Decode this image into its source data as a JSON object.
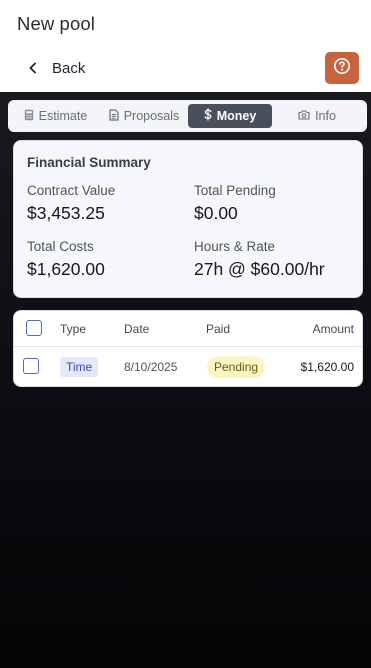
{
  "header": {
    "title": "New pool",
    "back_label": "Back",
    "back_icon": "chevron-left-icon",
    "help_icon": "question-circle-icon",
    "accent_color": "#c8633f"
  },
  "tabs": [
    {
      "label": "Estimate",
      "icon": "calculator-icon",
      "active": false
    },
    {
      "label": "Proposals",
      "icon": "document-icon",
      "active": false
    },
    {
      "label": "Money",
      "icon": "dollar-icon",
      "active": true
    },
    {
      "label": "Info",
      "icon": "camera-icon",
      "active": false
    }
  ],
  "summary": {
    "title": "Financial Summary",
    "contract_value": {
      "label": "Contract Value",
      "value": "$3,453.25"
    },
    "total_pending": {
      "label": "Total Pending",
      "value": "$0.00"
    },
    "total_costs": {
      "label": "Total Costs",
      "value": "$1,620.00"
    },
    "hours_rate": {
      "label": "Hours & Rate",
      "value": "27h @ $60.00/hr"
    }
  },
  "table": {
    "columns": [
      "Type",
      "Date",
      "Paid",
      "Amount"
    ],
    "rows": [
      {
        "type": "Time",
        "date": "8/10/2025",
        "paid": "Pending",
        "amount": "$1,620.00"
      }
    ]
  }
}
